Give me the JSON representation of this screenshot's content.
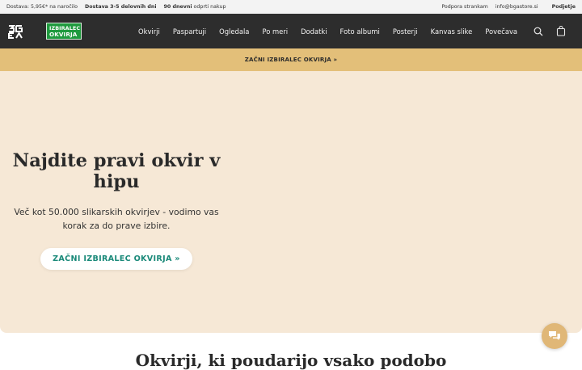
{
  "topbar": {
    "shipping_label": "Dostava: 5,95€* na naročilo",
    "delivery": "Dostava 3-5 delovnih dni",
    "returns_bold": "90 dnevni",
    "returns_rest": "odprti nakup",
    "support": "Podpora strankam",
    "email": "info@bgastore.si",
    "share": "Podjetje"
  },
  "nav": {
    "badge_line1": "IZBIRALEC",
    "badge_line2": "OKVIRJA",
    "menu": [
      "Okvirji",
      "Paspartuji",
      "Ogledala",
      "Po meri",
      "Dodatki",
      "Foto albumi",
      "Posterji",
      "Kanvas slike",
      "Povečava"
    ]
  },
  "promo": {
    "text": "ZAČNI IZBIRALEC OKVIRJA »"
  },
  "hero": {
    "title": "Najdite pravi okvir v hipu",
    "subtitle": "Več kot 50.000 slikarskih okvirjev - vodimo vas korak za do prave izbire.",
    "cta": "ZAČNI IZBIRALEC OKVIRJA »"
  },
  "section": {
    "title": "Okvirji, ki poudarijo vsako podobo"
  },
  "colors": {
    "nav_bg": "#2d2d2d",
    "promo_bg": "#e3bf79",
    "hero_bg": "#f6e8d6",
    "badge_bg": "#1f9a3e",
    "cta_text": "#1b8a7a"
  },
  "icons": {
    "logo": "brand-logo-icon",
    "search": "search-icon",
    "cart": "shopping-bag-icon",
    "chat": "chat-icon"
  }
}
